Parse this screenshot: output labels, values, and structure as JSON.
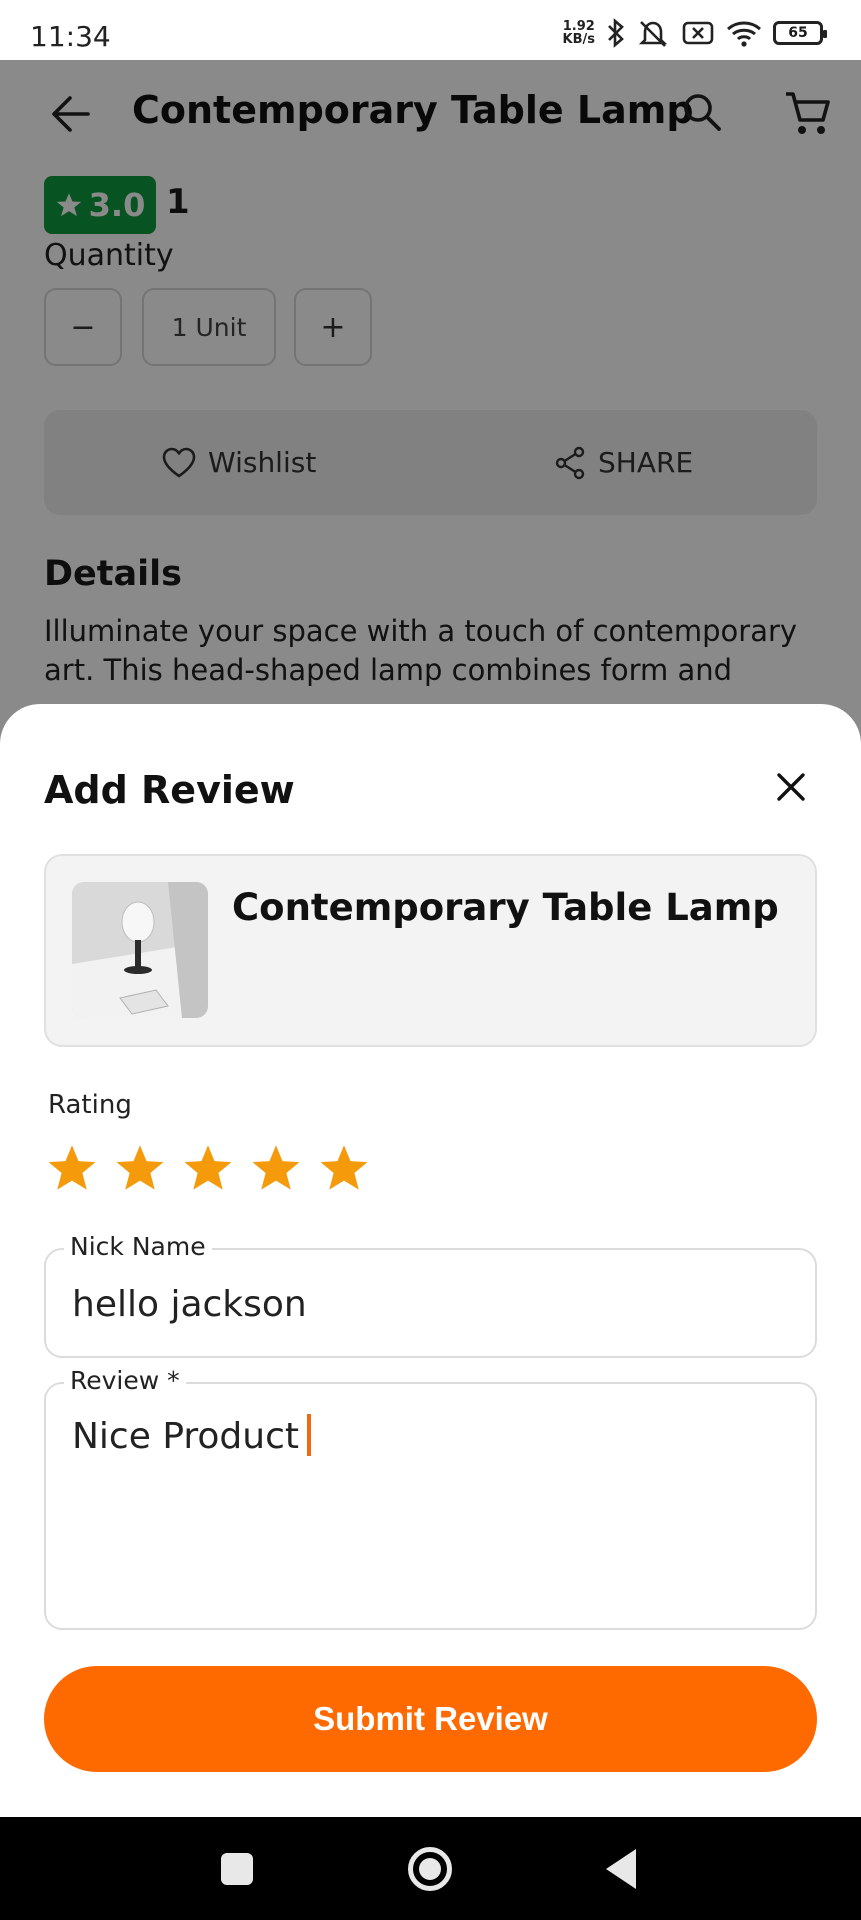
{
  "status_bar": {
    "time": "11:34",
    "net_speed_value": "1.92",
    "net_speed_unit": "KB/s",
    "battery": "65"
  },
  "product_page": {
    "title": "Contemporary Table Lamp",
    "rating": "3.0",
    "rating_count": "1",
    "quantity_label": "Quantity",
    "quantity_value": "1 Unit",
    "minus_symbol": "−",
    "plus_symbol": "+",
    "wishlist_label": "Wishlist",
    "share_label": "SHARE",
    "details_title": "Details",
    "details_text": "Illuminate your space with a touch of contemporary art. This head-shaped lamp combines form and"
  },
  "review_sheet": {
    "title": "Add Review",
    "product_name": "Contemporary Table Lamp",
    "rating_label": "Rating",
    "rating_value": 5,
    "rating_max": 5,
    "star_color": "#f59b0b",
    "nick_label": "Nick Name",
    "nick_value": "hello jackson",
    "review_label": "Review *",
    "review_value": "Nice Product",
    "submit_label": "Submit Review",
    "accent_color": "#ff6a00"
  }
}
